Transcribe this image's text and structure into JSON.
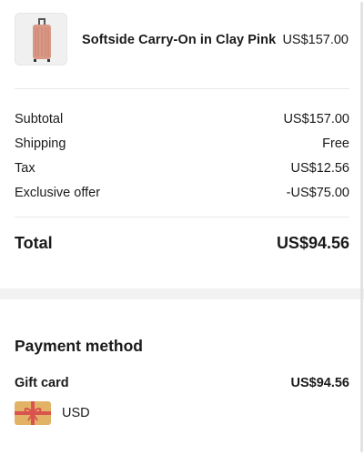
{
  "product": {
    "name": "Softside Carry-On in Clay Pink",
    "price": "US$157.00",
    "image_icon": "suitcase-icon"
  },
  "summary": {
    "rows": [
      {
        "label": "Subtotal",
        "value": "US$157.00"
      },
      {
        "label": "Shipping",
        "value": "Free"
      },
      {
        "label": "Tax",
        "value": "US$12.56"
      },
      {
        "label": "Exclusive offer",
        "value": "-US$75.00"
      }
    ],
    "total_label": "Total",
    "total_value": "US$94.56"
  },
  "payment": {
    "title": "Payment method",
    "method_label": "Gift card",
    "method_amount": "US$94.56",
    "currency": "USD",
    "card_icon": "gift-card-icon",
    "card_color": "#e2b366",
    "ribbon_color": "#d9534f"
  },
  "colors": {
    "suitcase": "#d99986",
    "divider": "#e8e8e8",
    "band": "#f2f2f2"
  }
}
